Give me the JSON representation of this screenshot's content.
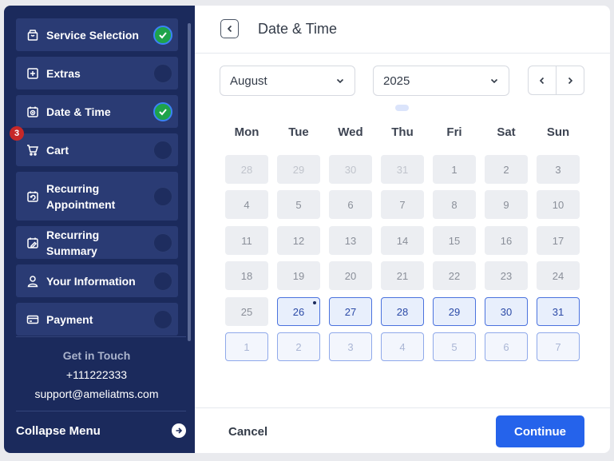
{
  "sidebar": {
    "steps": [
      {
        "label": "Service Selection",
        "icon": "bag-icon",
        "status": "completed"
      },
      {
        "label": "Extras",
        "icon": "plus-square-icon",
        "status": "pending"
      },
      {
        "label": "Date & Time",
        "icon": "calendar-clock-icon",
        "status": "completed"
      },
      {
        "label": "Cart",
        "icon": "cart-icon",
        "status": "pending",
        "badge": "3"
      },
      {
        "label": "Recurring Appointment",
        "icon": "calendar-repeat-icon",
        "status": "pending"
      },
      {
        "label": "Recurring Summary",
        "icon": "calendar-edit-icon",
        "status": "pending"
      },
      {
        "label": "Your Information",
        "icon": "user-icon",
        "status": "pending"
      },
      {
        "label": "Payment",
        "icon": "card-icon",
        "status": "pending"
      }
    ],
    "contact": {
      "title": "Get in Touch",
      "phone": "+111222333",
      "email": "support@ameliatms.com"
    },
    "collapse_label": "Collapse Menu"
  },
  "header": {
    "title": "Date & Time"
  },
  "controls": {
    "month": "August",
    "year": "2025"
  },
  "calendar": {
    "weekdays": [
      "Mon",
      "Tue",
      "Wed",
      "Thu",
      "Fri",
      "Sat",
      "Sun"
    ],
    "weeks": [
      [
        {
          "d": "28",
          "s": "faded"
        },
        {
          "d": "29",
          "s": "faded"
        },
        {
          "d": "30",
          "s": "faded"
        },
        {
          "d": "31",
          "s": "faded"
        },
        {
          "d": "1",
          "s": "disabled"
        },
        {
          "d": "2",
          "s": "disabled"
        },
        {
          "d": "3",
          "s": "disabled"
        }
      ],
      [
        {
          "d": "4",
          "s": "disabled"
        },
        {
          "d": "5",
          "s": "disabled"
        },
        {
          "d": "6",
          "s": "disabled"
        },
        {
          "d": "7",
          "s": "disabled"
        },
        {
          "d": "8",
          "s": "disabled"
        },
        {
          "d": "9",
          "s": "disabled"
        },
        {
          "d": "10",
          "s": "disabled"
        }
      ],
      [
        {
          "d": "11",
          "s": "disabled"
        },
        {
          "d": "12",
          "s": "disabled"
        },
        {
          "d": "13",
          "s": "disabled"
        },
        {
          "d": "14",
          "s": "disabled"
        },
        {
          "d": "15",
          "s": "disabled"
        },
        {
          "d": "16",
          "s": "disabled"
        },
        {
          "d": "17",
          "s": "disabled"
        }
      ],
      [
        {
          "d": "18",
          "s": "disabled"
        },
        {
          "d": "19",
          "s": "disabled"
        },
        {
          "d": "20",
          "s": "disabled"
        },
        {
          "d": "21",
          "s": "disabled"
        },
        {
          "d": "22",
          "s": "disabled"
        },
        {
          "d": "23",
          "s": "disabled"
        },
        {
          "d": "24",
          "s": "disabled"
        }
      ],
      [
        {
          "d": "25",
          "s": "disabled"
        },
        {
          "d": "26",
          "s": "avail",
          "today": true
        },
        {
          "d": "27",
          "s": "avail"
        },
        {
          "d": "28",
          "s": "avail"
        },
        {
          "d": "29",
          "s": "avail"
        },
        {
          "d": "30",
          "s": "avail"
        },
        {
          "d": "31",
          "s": "avail"
        }
      ],
      [
        {
          "d": "1",
          "s": "avail-faded"
        },
        {
          "d": "2",
          "s": "avail-faded"
        },
        {
          "d": "3",
          "s": "avail-faded"
        },
        {
          "d": "4",
          "s": "avail-faded"
        },
        {
          "d": "5",
          "s": "avail-faded"
        },
        {
          "d": "6",
          "s": "avail-faded"
        },
        {
          "d": "7",
          "s": "avail-faded"
        }
      ]
    ]
  },
  "footer": {
    "cancel_label": "Cancel",
    "continue_label": "Continue"
  },
  "colors": {
    "sidebar_bg": "#1b2a5c",
    "accent": "#2563eb",
    "completed": "#1ea34a"
  }
}
